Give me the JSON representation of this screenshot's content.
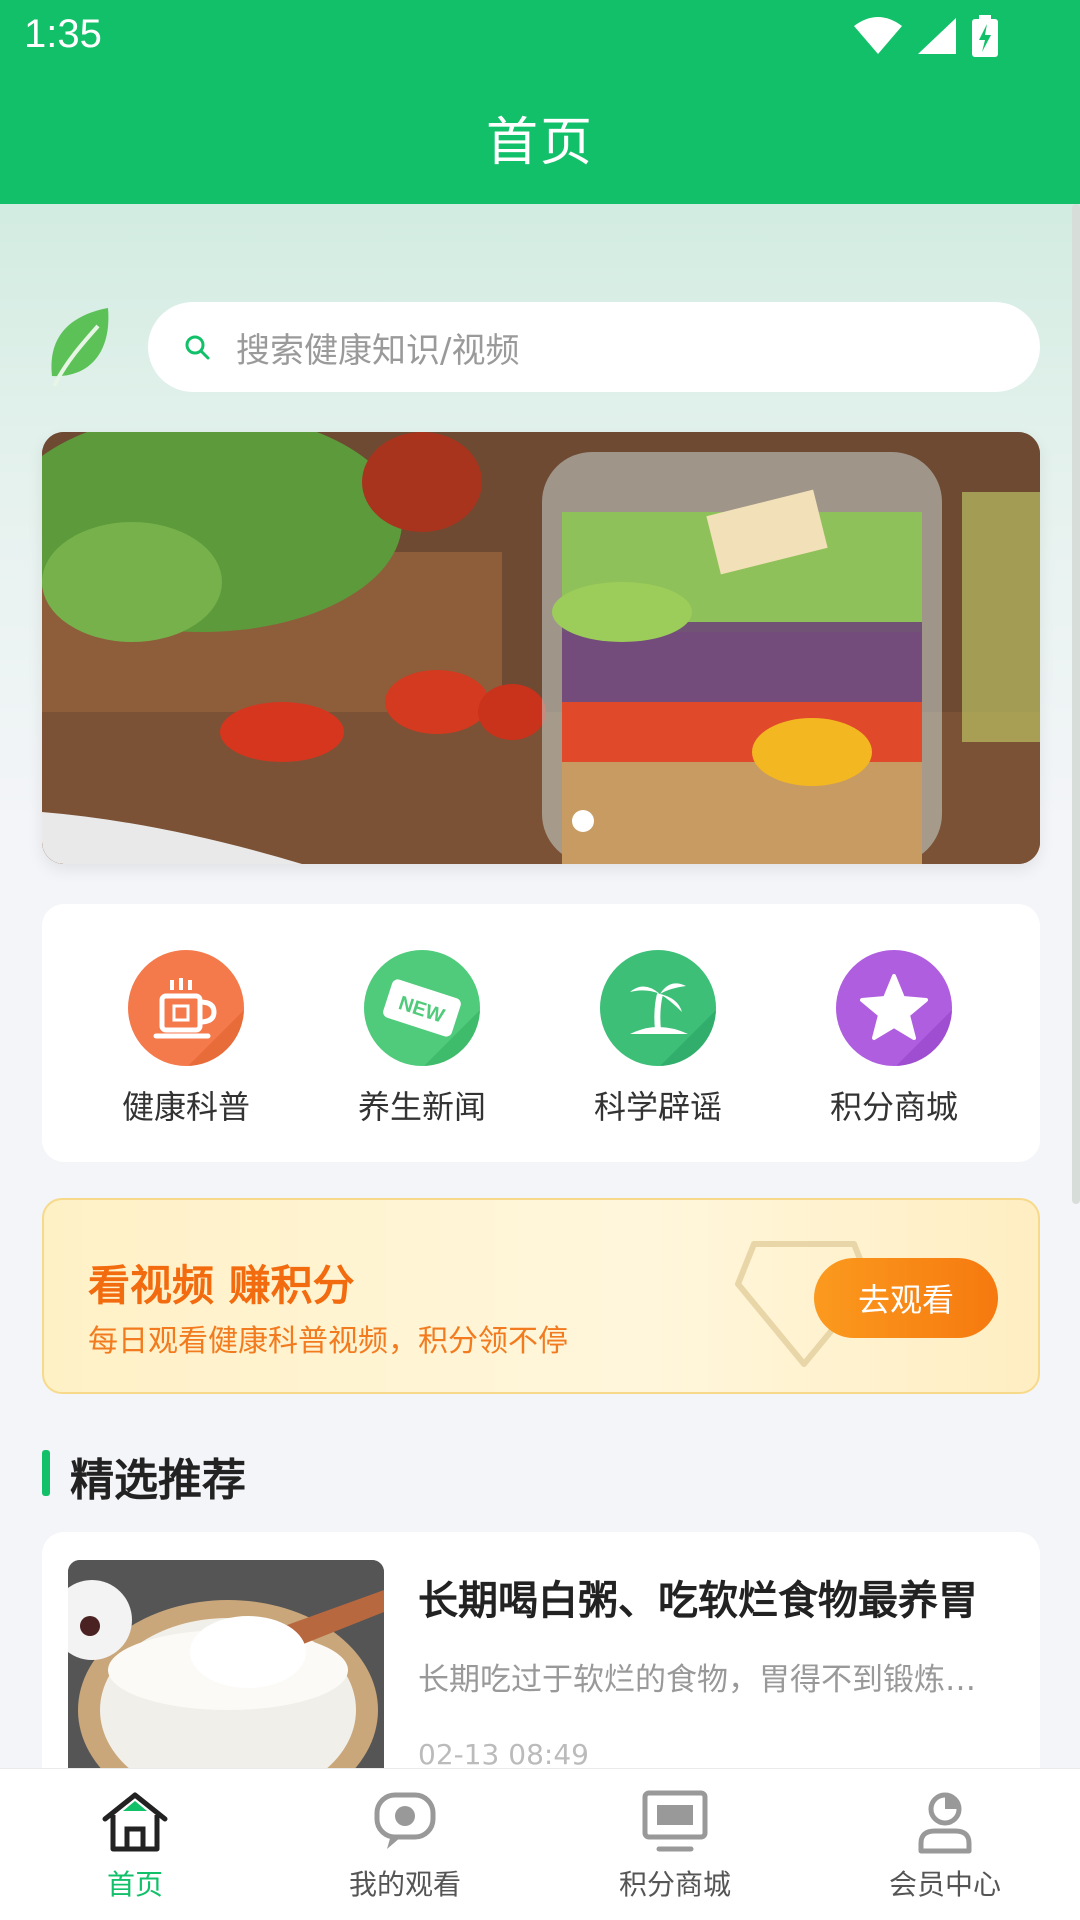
{
  "status_bar": {
    "time": "1:35"
  },
  "header": {
    "title": "首页"
  },
  "search": {
    "placeholder": "搜索健康知识/视频"
  },
  "categories": [
    {
      "label": "健康科普",
      "icon": "tea-cup-icon",
      "color": "#f47a4c"
    },
    {
      "label": "养生新闻",
      "icon": "new-tag-icon",
      "color": "#4fcb7b"
    },
    {
      "label": "科学辟谣",
      "icon": "palm-island-icon",
      "color": "#3dbf78"
    },
    {
      "label": "积分商城",
      "icon": "star-icon",
      "color": "#b05ee0"
    }
  ],
  "promo": {
    "title": "看视频 赚积分",
    "subtitle": "每日观看健康科普视频，积分领不停",
    "button": "去观看"
  },
  "section": {
    "title": "精选推荐"
  },
  "articles": [
    {
      "title": "长期喝白粥、吃软烂食物最养胃",
      "desc": "长期吃过于软烂的食物，胃得不到锻炼…",
      "time": "02-13 08:49"
    }
  ],
  "bottom_nav": [
    {
      "label": "首页",
      "icon": "home-icon",
      "active": true
    },
    {
      "label": "我的观看",
      "icon": "chat-bubble-icon",
      "active": false
    },
    {
      "label": "积分商城",
      "icon": "monitor-icon",
      "active": false
    },
    {
      "label": "会员中心",
      "icon": "user-icon",
      "active": false
    }
  ],
  "colors": {
    "brand": "#12c06a",
    "accent": "#f6790f"
  }
}
